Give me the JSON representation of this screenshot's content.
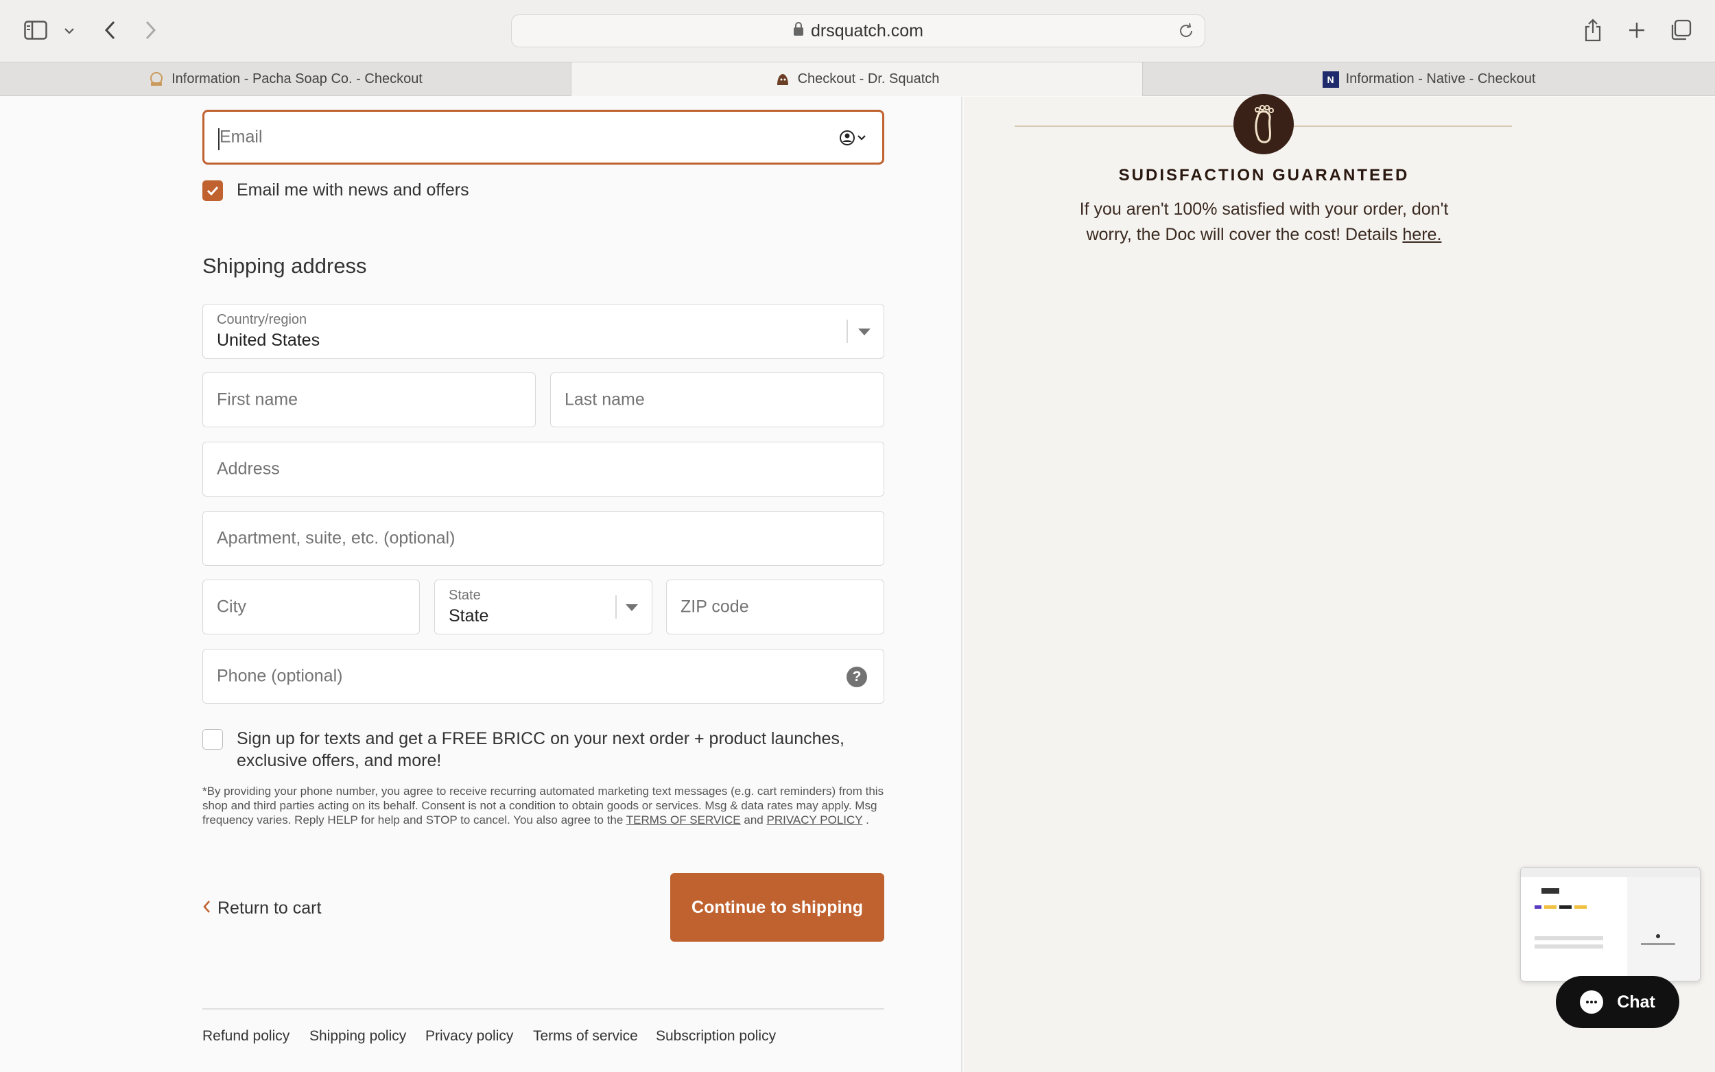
{
  "browser": {
    "url": "drsquatch.com",
    "tabs": [
      {
        "label": "Information - Pacha Soap Co. - Checkout",
        "active": false
      },
      {
        "label": "Checkout - Dr. Squatch",
        "active": true
      },
      {
        "label": "Information - Native - Checkout",
        "active": false
      }
    ],
    "native_favicon_letter": "N"
  },
  "form": {
    "email_placeholder": "Email",
    "news_checkbox_label": "Email me with news and offers",
    "news_checked": true,
    "shipping_heading": "Shipping address",
    "country_label": "Country/region",
    "country_value": "United States",
    "first_name_placeholder": "First name",
    "last_name_placeholder": "Last name",
    "address_placeholder": "Address",
    "apartment_placeholder": "Apartment, suite, etc. (optional)",
    "city_placeholder": "City",
    "state_label": "State",
    "state_value": "State",
    "zip_placeholder": "ZIP code",
    "phone_placeholder": "Phone (optional)",
    "sms_checkbox_label_line1": "Sign up for texts and get a FREE BRICC on your next order + product launches,",
    "sms_checkbox_label_line2": "exclusive offers, and more!",
    "sms_checked": false,
    "disclaimer": "*By providing your phone number, you agree to receive recurring automated marketing text messages (e.g. cart reminders) from this shop and third parties acting on its behalf. Consent is not a condition to obtain goods or services. Msg & data rates may apply. Msg frequency varies. Reply HELP for help and STOP to cancel. You also agree to the",
    "terms_link": "TERMS OF SERVICE",
    "and_text": "and",
    "privacy_link": "PRIVACY POLICY",
    "period": ".",
    "return_label": "Return to cart",
    "continue_label": "Continue to shipping"
  },
  "footer": {
    "links": [
      "Refund policy",
      "Shipping policy",
      "Privacy policy",
      "Terms of service",
      "Subscription policy"
    ]
  },
  "guarantee": {
    "title": "SUDISFACTION GUARANTEED",
    "text": "If you aren't 100% satisfied with your order, don't worry, the Doc will cover the cost! Details",
    "link": "here."
  },
  "chat": {
    "label": "Chat"
  },
  "colors": {
    "accent": "#c0622f",
    "brand_dark": "#3a2117"
  }
}
